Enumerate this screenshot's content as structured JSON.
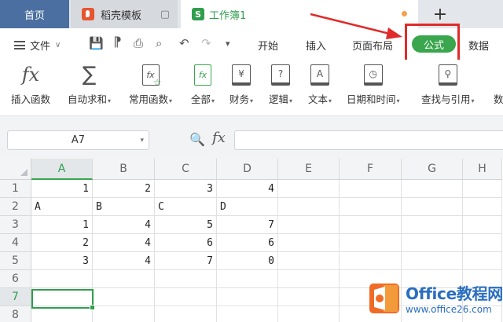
{
  "tabs": {
    "home": "首页",
    "docer": "稻壳模板",
    "book": "工作簿1",
    "book_logo": "S"
  },
  "menu": {
    "file": "文件",
    "items": [
      "开始",
      "插入",
      "页面布局",
      "公式",
      "数据"
    ]
  },
  "ribbon": {
    "items": [
      {
        "label": "插入函数",
        "icon": "fx-icon",
        "glyph": "fx",
        "dropdown": false
      },
      {
        "label": "自动求和",
        "icon": "sum-icon",
        "glyph": "∑",
        "dropdown": true
      },
      {
        "label": "常用函数",
        "icon": "common-function-icon",
        "glyph": "fx",
        "dropdown": true
      },
      {
        "label": "全部",
        "icon": "all-functions-icon",
        "glyph": "fx",
        "dropdown": true
      },
      {
        "label": "财务",
        "icon": "finance-icon",
        "glyph": "¥",
        "dropdown": true
      },
      {
        "label": "逻辑",
        "icon": "logic-icon",
        "glyph": "?",
        "dropdown": true
      },
      {
        "label": "文本",
        "icon": "text-icon",
        "glyph": "A",
        "dropdown": true
      },
      {
        "label": "日期和时间",
        "icon": "datetime-icon",
        "glyph": "◷",
        "dropdown": true
      },
      {
        "label": "查找与引用",
        "icon": "lookup-icon",
        "glyph": "⚲",
        "dropdown": true
      },
      {
        "label": "数",
        "icon": "math-icon",
        "glyph": "",
        "dropdown": false
      }
    ]
  },
  "formula_bar": {
    "name_box": "A7",
    "fx": "fx",
    "value": ""
  },
  "sheet": {
    "columns": [
      "A",
      "B",
      "C",
      "D",
      "E",
      "F",
      "G",
      "H"
    ],
    "selected_column": "A",
    "rows": [
      {
        "num": "1",
        "cells": [
          {
            "v": "1",
            "t": "num"
          },
          {
            "v": "2",
            "t": "num"
          },
          {
            "v": "3",
            "t": "num"
          },
          {
            "v": "4",
            "t": "num"
          }
        ]
      },
      {
        "num": "2",
        "cells": [
          {
            "v": "A",
            "t": "txt"
          },
          {
            "v": "B",
            "t": "txt"
          },
          {
            "v": "C",
            "t": "txt"
          },
          {
            "v": "D",
            "t": "txt"
          }
        ]
      },
      {
        "num": "3",
        "cells": [
          {
            "v": "1",
            "t": "num"
          },
          {
            "v": "4",
            "t": "num"
          },
          {
            "v": "5",
            "t": "num"
          },
          {
            "v": "7",
            "t": "num"
          }
        ]
      },
      {
        "num": "4",
        "cells": [
          {
            "v": "2",
            "t": "num"
          },
          {
            "v": "4",
            "t": "num"
          },
          {
            "v": "6",
            "t": "num"
          },
          {
            "v": "6",
            "t": "num"
          }
        ]
      },
      {
        "num": "5",
        "cells": [
          {
            "v": "3",
            "t": "num"
          },
          {
            "v": "4",
            "t": "num"
          },
          {
            "v": "7",
            "t": "num"
          },
          {
            "v": "0",
            "t": "num"
          }
        ]
      },
      {
        "num": "6",
        "cells": []
      },
      {
        "num": "7",
        "cells": []
      },
      {
        "num": "8",
        "cells": []
      }
    ],
    "selected_row": "7"
  },
  "watermark": {
    "main": "Office教程网",
    "sub": "www.office26.com"
  },
  "colors": {
    "accent_green": "#3aa64e",
    "highlight_red": "#e02b2b",
    "home_tab": "#4a6fa0"
  }
}
